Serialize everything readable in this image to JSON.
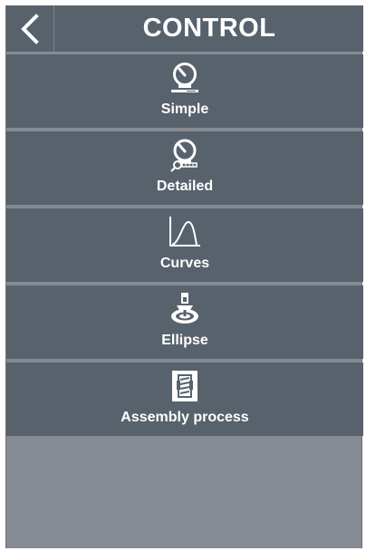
{
  "header": {
    "title": "CONTROL",
    "back_icon": "chevron-left-icon"
  },
  "menu": {
    "items": [
      {
        "label": "Simple",
        "icon": "gauge-icon"
      },
      {
        "label": "Detailed",
        "icon": "gauge-magnifier-icon"
      },
      {
        "label": "Curves",
        "icon": "curve-chart-icon"
      },
      {
        "label": "Ellipse",
        "icon": "ellipse-tool-icon"
      },
      {
        "label": "Assembly process",
        "icon": "assembly-process-icon"
      }
    ]
  },
  "colors": {
    "header_bg": "#58626c",
    "item_bg": "#58626c",
    "panel_bg": "#858a93",
    "text": "#ffffff"
  }
}
